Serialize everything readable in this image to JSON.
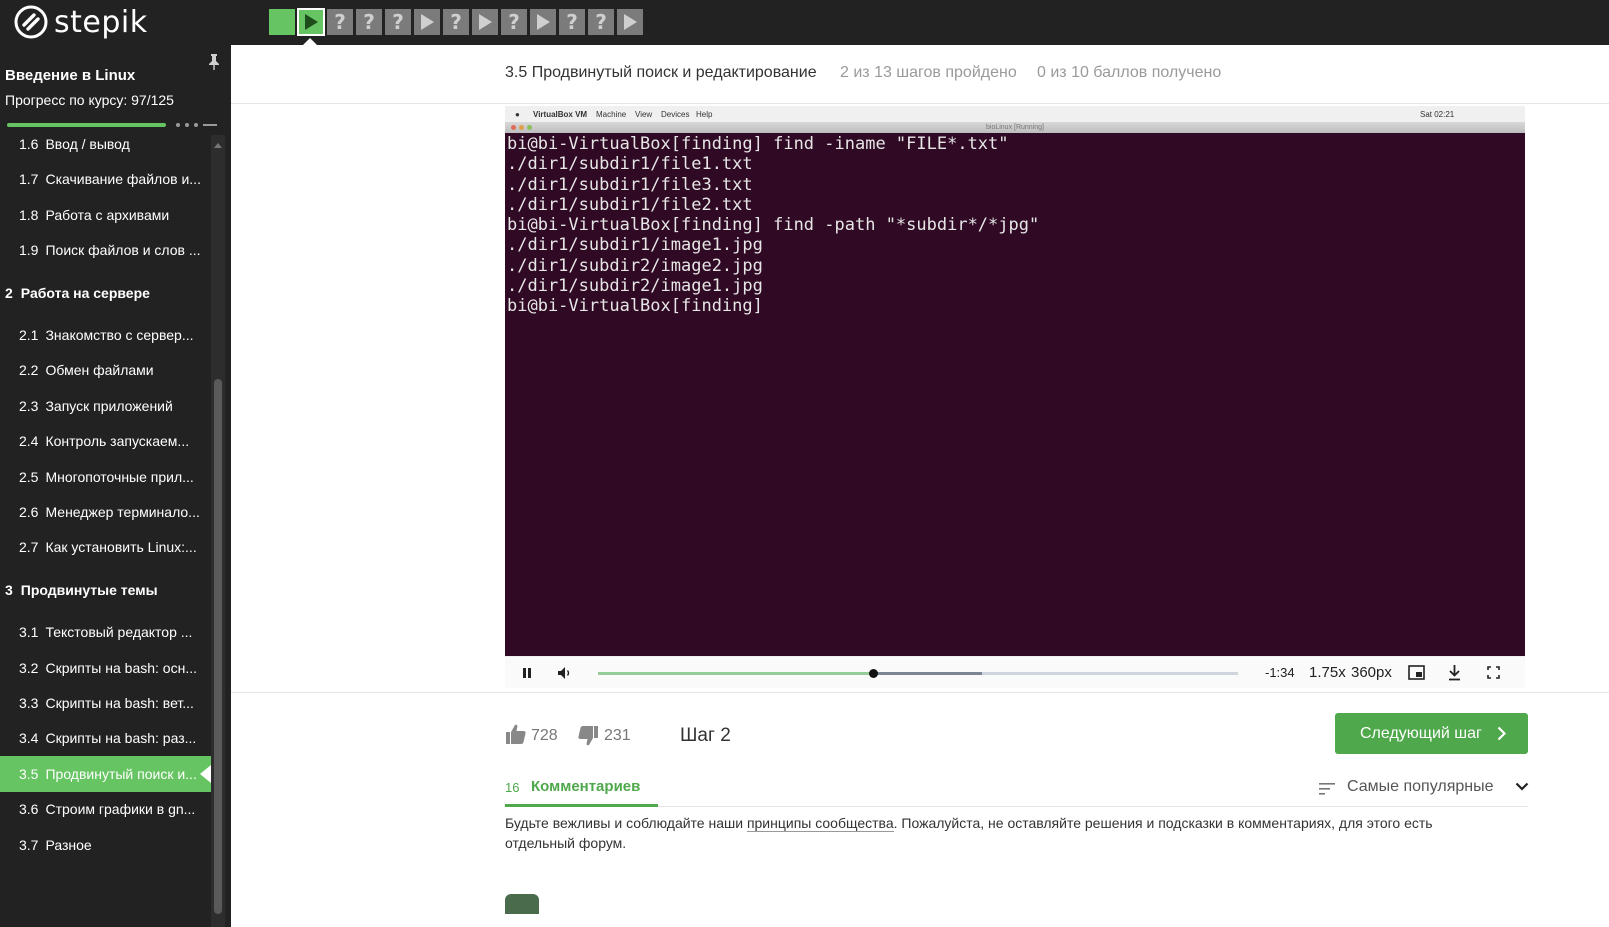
{
  "topbar": {
    "logo_text": "stepik",
    "steps": [
      {
        "type": "done",
        "icon": "square"
      },
      {
        "type": "current",
        "icon": "play-icon"
      },
      {
        "type": "pending",
        "symbol": "?"
      },
      {
        "type": "pending",
        "symbol": "?"
      },
      {
        "type": "pending",
        "symbol": "?"
      },
      {
        "type": "pending",
        "icon": "play-icon"
      },
      {
        "type": "pending",
        "symbol": "?"
      },
      {
        "type": "pending",
        "icon": "play-icon"
      },
      {
        "type": "pending",
        "symbol": "?"
      },
      {
        "type": "pending",
        "icon": "play-icon"
      },
      {
        "type": "pending",
        "symbol": "?"
      },
      {
        "type": "pending",
        "symbol": "?"
      },
      {
        "type": "pending",
        "icon": "play-icon"
      }
    ]
  },
  "sidebar": {
    "course_title": "Введение в Linux",
    "progress_text": "Прогресс по курсу:  97/125",
    "progress_fraction": 0.776,
    "items": [
      {
        "kind": "item",
        "num": "1.6",
        "label": "Ввод / вывод"
      },
      {
        "kind": "item",
        "num": "1.7",
        "label": "Скачивание файлов и..."
      },
      {
        "kind": "item",
        "num": "1.8",
        "label": "Работа с архивами"
      },
      {
        "kind": "item",
        "num": "1.9",
        "label": "Поиск файлов и слов ..."
      },
      {
        "kind": "section",
        "num": "2",
        "label": "Работа на сервере"
      },
      {
        "kind": "item",
        "num": "2.1",
        "label": "Знакомство с сервер..."
      },
      {
        "kind": "item",
        "num": "2.2",
        "label": "Обмен файлами"
      },
      {
        "kind": "item",
        "num": "2.3",
        "label": "Запуск приложений"
      },
      {
        "kind": "item",
        "num": "2.4",
        "label": "Контроль запускаем..."
      },
      {
        "kind": "item",
        "num": "2.5",
        "label": "Многопоточные прил..."
      },
      {
        "kind": "item",
        "num": "2.6",
        "label": "Менеджер терминало..."
      },
      {
        "kind": "item",
        "num": "2.7",
        "label": "Как установить Linux:..."
      },
      {
        "kind": "section",
        "num": "3",
        "label": "Продвинутые темы"
      },
      {
        "kind": "item",
        "num": "3.1",
        "label": "Текстовый редактор ..."
      },
      {
        "kind": "item",
        "num": "3.2",
        "label": "Скрипты на bash: осн..."
      },
      {
        "kind": "item",
        "num": "3.3",
        "label": "Скрипты на bash: вет..."
      },
      {
        "kind": "item",
        "num": "3.4",
        "label": "Скрипты на bash: раз..."
      },
      {
        "kind": "item",
        "num": "3.5",
        "label": "Продвинутый поиск и...",
        "active": true
      },
      {
        "kind": "item",
        "num": "3.6",
        "label": "Строим графики в gn..."
      },
      {
        "kind": "item",
        "num": "3.7",
        "label": "Разное"
      }
    ]
  },
  "lesson": {
    "title": "3.5 Продвинутый поиск и редактирование",
    "steps_done": "2 из 13 шагов пройдено",
    "points": "0 из 10 баллов  получено"
  },
  "video": {
    "vm_menu": [
      "VirtualBox VM",
      "Machine",
      "View",
      "Devices",
      "Help"
    ],
    "vm_clock": "Sat 02:21",
    "vm_window_title": "bioLinux [Running]",
    "terminal_lines": [
      "bi@bi-VirtualBox[finding] find -iname \"FILE*.txt\"",
      "./dir1/subdir1/file1.txt",
      "./dir1/subdir1/file3.txt",
      "./dir1/subdir1/file2.txt",
      "bi@bi-VirtualBox[finding] find -path \"*subdir*/*jpg\"",
      "./dir1/subdir1/image1.jpg",
      "./dir1/subdir2/image2.jpg",
      "./dir1/subdir2/image1.jpg",
      "bi@bi-VirtualBox[finding]"
    ],
    "controls": {
      "time_left": "-1:34",
      "speed": "1.75x",
      "quality": "360px",
      "played_fraction": 0.43,
      "buffered_fraction": 0.6
    }
  },
  "footer": {
    "likes": "728",
    "dislikes": "231",
    "step_label": "Шаг 2",
    "next_button": "Следующий шаг"
  },
  "comments": {
    "count": "16",
    "label": "Комментариев",
    "sort_label": "Самые популярные",
    "rules_before": "Будьте вежливы и соблюдайте наши ",
    "rules_link": "принципы сообщества",
    "rules_after": ". Пожалуйста, не оставляйте решения и подсказки в комментариях, для этого есть отдельный форум."
  },
  "colors": {
    "accent": "#4fa84b",
    "step_done": "#66c562",
    "terminal_bg": "#300a24",
    "sidebar_bg": "#222222"
  }
}
